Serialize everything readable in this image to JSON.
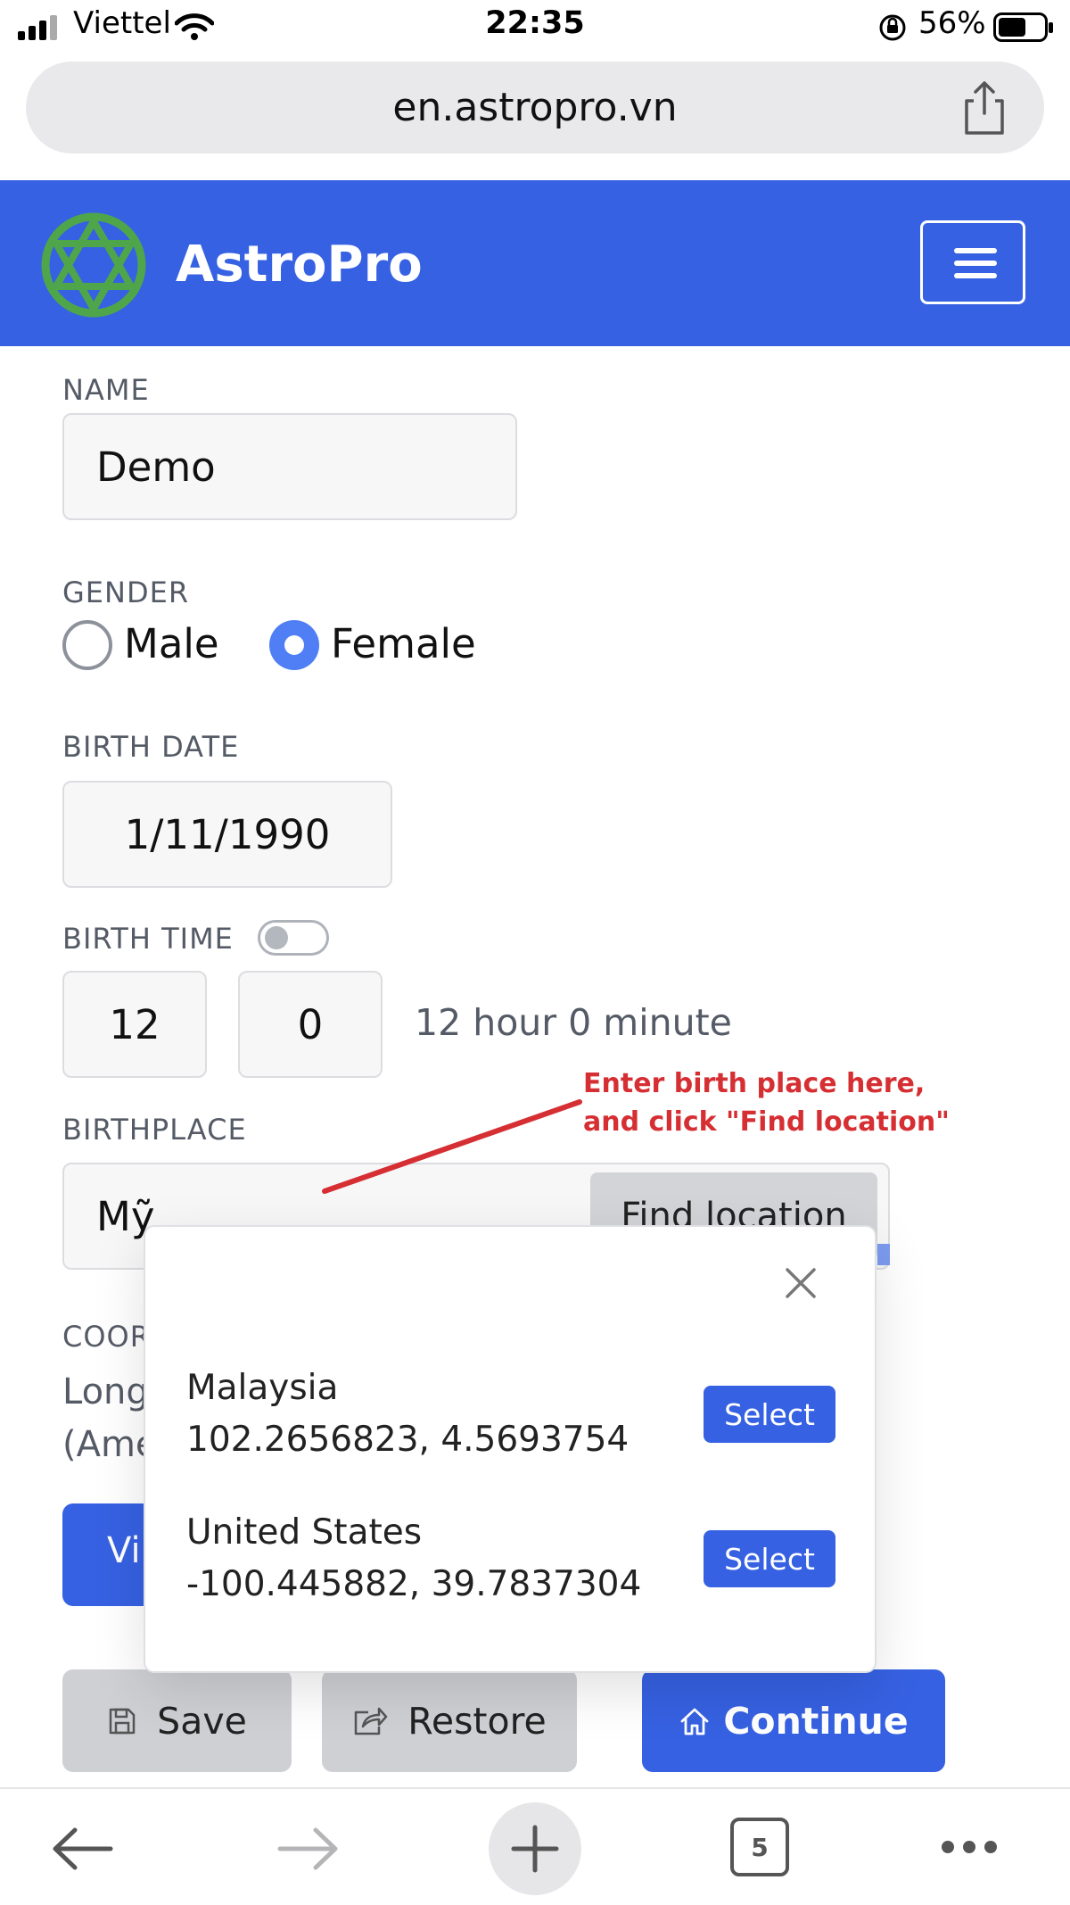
{
  "status_bar": {
    "carrier": "Viettel",
    "time": "22:35",
    "battery": "56%"
  },
  "browser": {
    "url": "en.astropro.vn",
    "tab_count": "5"
  },
  "navbar": {
    "brand": "AstroPro"
  },
  "form": {
    "name_label": "NAME",
    "name_value": "Demo",
    "gender_label": "GENDER",
    "gender_options": [
      "Male",
      "Female"
    ],
    "gender_selected": "Female",
    "birth_date_label": "BIRTH DATE",
    "birth_date_value": "1/11/1990",
    "birth_time_label": "BIRTH TIME",
    "hour_value": "12",
    "minute_value": "0",
    "time_text": "12 hour 0 minute",
    "birthplace_label": "BIRTHPLACE",
    "birthplace_value": "Mỹ",
    "find_location_label": "Find location",
    "coord_label_partial": "COOR",
    "coord_text_line1_partial": "Long",
    "coord_text_line2_partial": "(Ame",
    "view_button_partial": "Vi"
  },
  "annotation": {
    "line1": "Enter birth place here,",
    "line2": "and click \"Find location\""
  },
  "location_modal": {
    "results": [
      {
        "name": "Malaysia",
        "coords": "102.2656823, 4.5693754",
        "button": "Select"
      },
      {
        "name": "United States",
        "coords": "-100.445882, 39.7837304",
        "button": "Select"
      }
    ]
  },
  "actions": {
    "save": "Save",
    "restore": "Restore",
    "continue": "Continue"
  },
  "colors": {
    "primary": "#3661e2",
    "annotation": "#d62f33",
    "logo": "#4fa64a"
  }
}
